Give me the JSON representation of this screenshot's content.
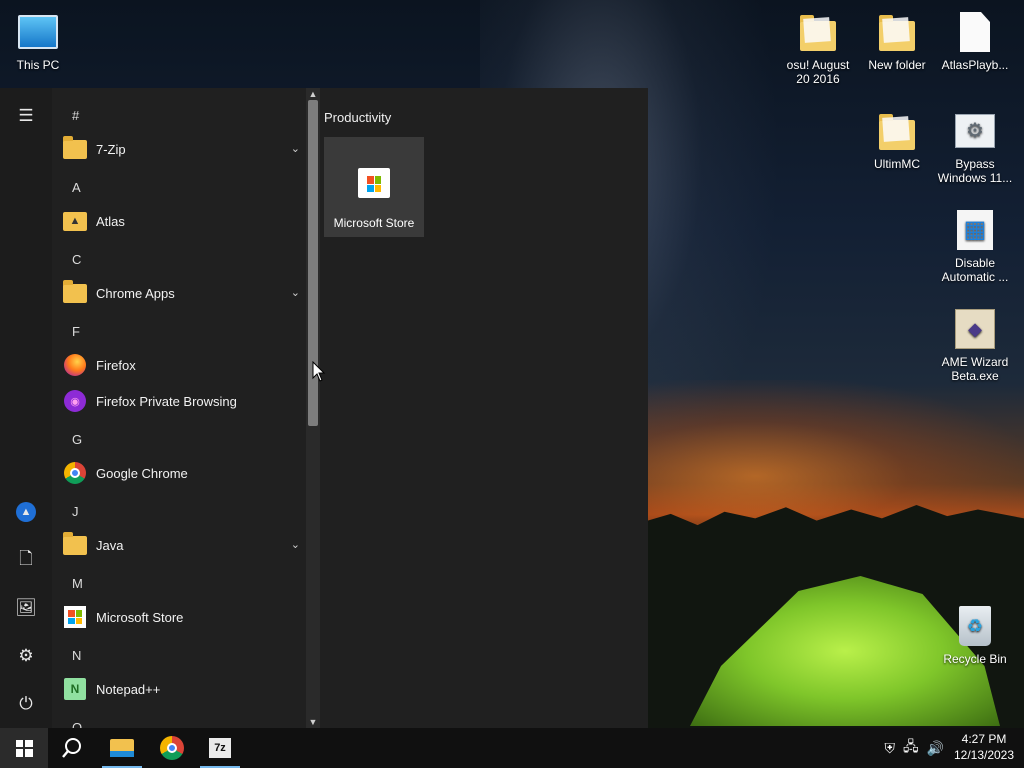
{
  "desktop": {
    "icons": {
      "this_pc": "This PC",
      "osu": "osu! August 20 2016",
      "new_folder": "New folder",
      "atlas_playbook": "AtlasPlayb...",
      "ultimmc": "UltimMC",
      "bypass": "Bypass Windows 11...",
      "disable": "Disable Automatic ...",
      "ame_wizard": "AME Wizard Beta.exe",
      "recycle_bin": "Recycle Bin"
    }
  },
  "start_menu": {
    "groups": [
      {
        "header": "#",
        "apps": [
          {
            "label": "7-Zip",
            "expandable": true
          }
        ]
      },
      {
        "header": "A",
        "apps": [
          {
            "label": "Atlas"
          }
        ]
      },
      {
        "header": "C",
        "apps": [
          {
            "label": "Chrome Apps",
            "expandable": true
          }
        ]
      },
      {
        "header": "F",
        "apps": [
          {
            "label": "Firefox"
          },
          {
            "label": "Firefox Private Browsing"
          }
        ]
      },
      {
        "header": "G",
        "apps": [
          {
            "label": "Google Chrome"
          }
        ]
      },
      {
        "header": "J",
        "apps": [
          {
            "label": "Java",
            "expandable": true
          }
        ]
      },
      {
        "header": "M",
        "apps": [
          {
            "label": "Microsoft Store"
          }
        ]
      },
      {
        "header": "N",
        "apps": [
          {
            "label": "Notepad++"
          }
        ]
      },
      {
        "header": "O",
        "apps": []
      }
    ],
    "tiles_group_title": "Productivity",
    "tile_label": "Microsoft Store"
  },
  "taskbar": {
    "time": "4:27 PM",
    "date": "12/13/2023"
  },
  "colors": {
    "start_bg": "#202020",
    "taskbar_bg": "#101010",
    "accent": "#76b9ed"
  }
}
